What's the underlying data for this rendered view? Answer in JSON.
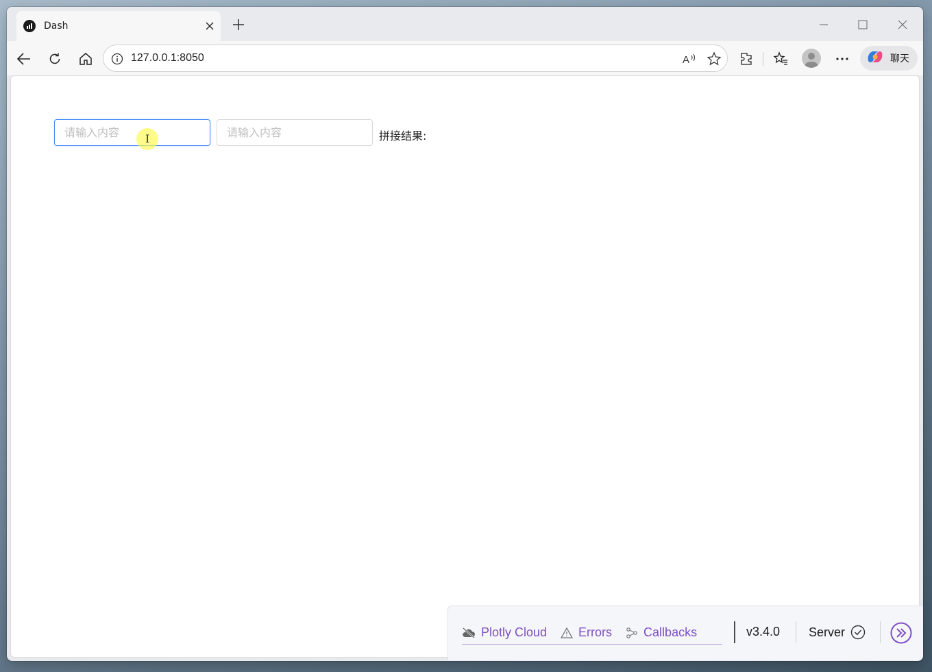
{
  "browser": {
    "tab": {
      "title": "Dash",
      "favicon": "dash-favicon-icon"
    },
    "address": {
      "url": "127.0.0.1:8050"
    },
    "copilot_label": "聊天"
  },
  "page": {
    "input1": {
      "placeholder": "请输入内容",
      "value": ""
    },
    "input2": {
      "placeholder": "请输入内容",
      "value": ""
    },
    "result_label": "拼接结果:"
  },
  "debug_bar": {
    "plotly_cloud": "Plotly Cloud",
    "errors": "Errors",
    "callbacks": "Callbacks",
    "version": "v3.4.0",
    "server": "Server",
    "accent_color": "#7e4fc3"
  }
}
